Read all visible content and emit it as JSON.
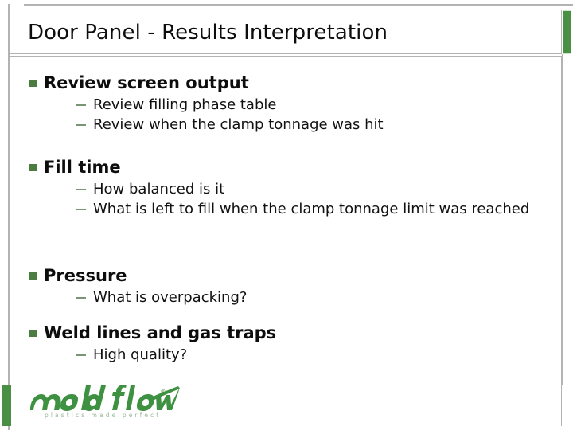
{
  "slide": {
    "title": "Door Panel - Results Interpretation",
    "accent_color": "#4a9044",
    "bullet_color": "#4a7d3f",
    "dash_color": "#7a9476",
    "text_color": "#0d0d0d",
    "frame_color": "#b3b3b3"
  },
  "content": {
    "sections": [
      {
        "heading": "Review screen output",
        "items": [
          "Review filling phase table",
          "Review when the clamp tonnage was hit"
        ]
      },
      {
        "heading": "Fill time",
        "items": [
          "How balanced is it",
          "What is left to fill when the clamp tonnage limit was reached"
        ]
      },
      {
        "heading": "Pressure",
        "items": [
          "What is overpacking?"
        ]
      },
      {
        "heading": "Weld lines and gas traps",
        "items": [
          "High quality?"
        ]
      }
    ]
  },
  "footer": {
    "logo_text": "moldflow",
    "logo_tagline": "plastics made perfect",
    "logo_trademark": "®",
    "logo_color": "#3f9142"
  }
}
